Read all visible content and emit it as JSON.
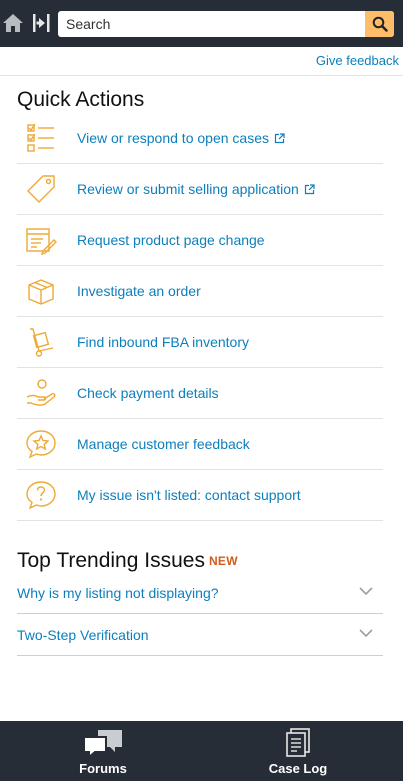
{
  "header": {
    "search_placeholder": "Search"
  },
  "subbar": {
    "give_feedback": "Give feedback"
  },
  "quick_actions": {
    "title": "Quick Actions",
    "items": [
      {
        "label": "View or respond to open cases",
        "icon": "checklist-icon",
        "external": true
      },
      {
        "label": "Review or submit selling application",
        "icon": "tag-icon",
        "external": true
      },
      {
        "label": "Request product page change",
        "icon": "edit-document-icon",
        "external": false
      },
      {
        "label": "Investigate an order",
        "icon": "box-icon",
        "external": false
      },
      {
        "label": "Find inbound FBA inventory",
        "icon": "hand-truck-icon",
        "external": false
      },
      {
        "label": "Check payment details",
        "icon": "hand-coin-icon",
        "external": false
      },
      {
        "label": "Manage customer feedback",
        "icon": "star-speech-bubble-icon",
        "external": false
      },
      {
        "label": "My issue isn't listed: contact support",
        "icon": "question-speech-bubble-icon",
        "external": false
      }
    ]
  },
  "trending": {
    "title": "Top Trending Issues",
    "badge": "NEW",
    "items": [
      {
        "label": "Why is my listing not displaying?"
      },
      {
        "label": "Two-Step Verification"
      }
    ]
  },
  "bottom_nav": {
    "forums": "Forums",
    "case_log": "Case Log"
  },
  "colors": {
    "header_bg": "#262d36",
    "link": "#0c7fbc",
    "icon_accent": "#f0a936",
    "search_button": "#febd69",
    "new_badge": "#d15c1b"
  }
}
